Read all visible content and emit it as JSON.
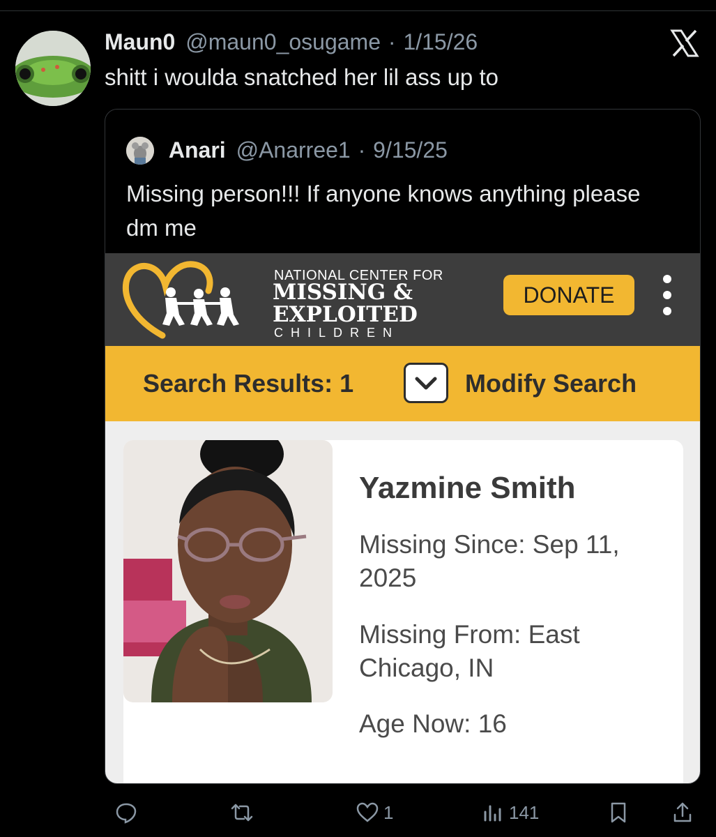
{
  "tweet": {
    "author_name": "Maun0",
    "author_handle": "@maun0_osugame",
    "date": "1/15/26",
    "separator": "·",
    "text": "shitt i woulda snatched her lil ass up to",
    "avatar_icon": "frog-avatar-icon"
  },
  "quote": {
    "author_name": "Anari",
    "author_handle": "@Anarree1",
    "date": "9/15/25",
    "separator": "·",
    "text": "Missing person!!! If anyone knows anything please dm me"
  },
  "embed": {
    "org_line1": "NATIONAL CENTER FOR",
    "org_line2": "MISSING &",
    "org_line3": "EXPLOITED",
    "org_line4": "CHILDREN",
    "donate_label": "DONATE",
    "search_results_label": "Search Results: 1",
    "modify_search_label": "Modify Search",
    "accent_color": "#f2b731",
    "bar_color": "#3d3d3d",
    "person": {
      "name": "Yazmine Smith",
      "missing_since": "Missing Since: Sep 11, 2025",
      "missing_from": "Missing From: East Chicago, IN",
      "age_now": "Age Now: 16"
    }
  },
  "actions": {
    "reply_count": "",
    "retweet_count": "",
    "like_count": "1",
    "views_count": "141"
  }
}
